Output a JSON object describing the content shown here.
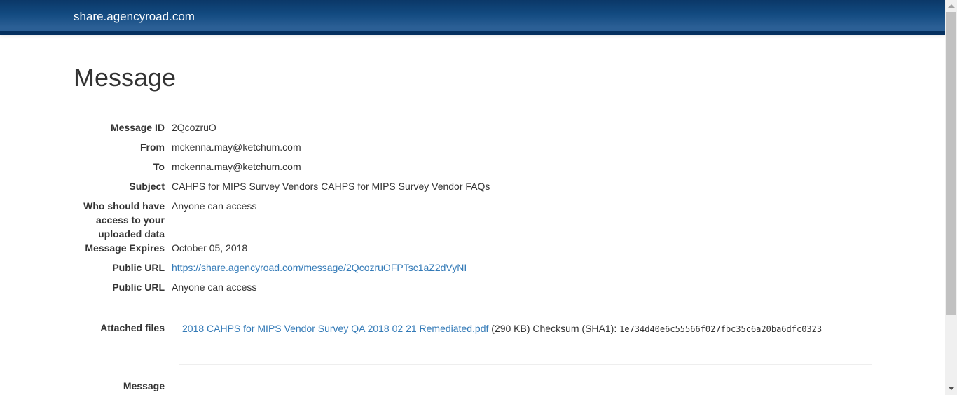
{
  "brand": "share.agencyroad.com",
  "title": "Message",
  "fields": {
    "message_id": {
      "label": "Message ID",
      "value": "2QcozruO"
    },
    "from": {
      "label": "From",
      "value": "mckenna.may@ketchum.com"
    },
    "to": {
      "label": "To",
      "value": "mckenna.may@ketchum.com"
    },
    "subject": {
      "label": "Subject",
      "value": "CAHPS for MIPS Survey Vendors CAHPS for MIPS Survey Vendor FAQs"
    },
    "access": {
      "label": "Who should have access to your uploaded data",
      "value": "Anyone can access"
    },
    "expires": {
      "label": "Message Expires",
      "value": "October 05, 2018"
    },
    "public_url": {
      "label": "Public URL",
      "value": "https://share.agencyroad.com/message/2QcozruOFPTsc1aZ2dVyNI"
    },
    "public_url2": {
      "label": "Public URL",
      "value": "Anyone can access"
    },
    "attached": {
      "label": "Attached files",
      "file": "2018 CAHPS for MIPS Vendor Survey QA 2018 02 21 Remediated.pdf",
      "size": "(290 KB)",
      "checksum_label": "Checksum (SHA1):",
      "checksum": "1e734d40e6c55566f027fbc35c6a20ba6dfc0323"
    },
    "message": {
      "label": "Message"
    }
  }
}
